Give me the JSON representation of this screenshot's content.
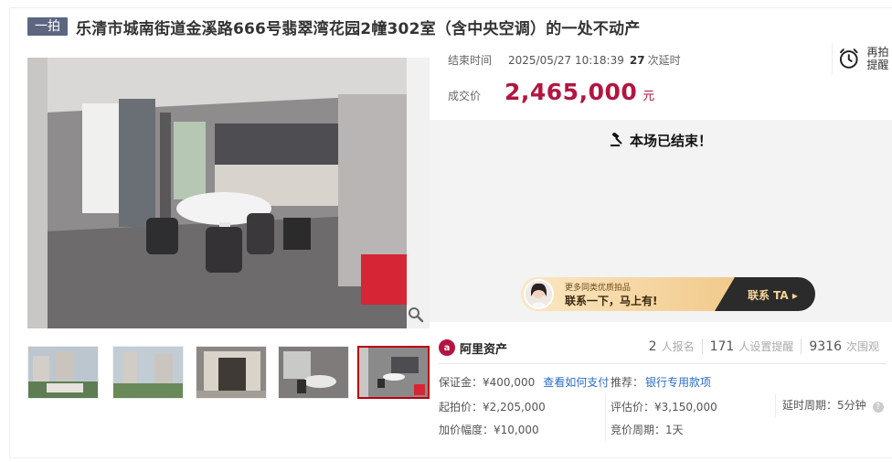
{
  "title": {
    "badge": "一拍",
    "text": "乐清市城南街道金溪路666号翡翠湾花园2幢302室（含中央空调）的一处不动产"
  },
  "auction": {
    "end_label": "结束时间",
    "end_time": "2025/05/27 10:18:39",
    "delay_count": "27",
    "delay_label": "次延时",
    "deal_label": "成交价",
    "deal_price": "2,465,000",
    "deal_unit": "元",
    "ended_message": "本场已结束！",
    "remind_label": "再拍提醒"
  },
  "banner": {
    "subtitle": "更多同类优质拍品",
    "headline": "联系一下，马上有!",
    "cta": "联系 TA ▸"
  },
  "platform": {
    "logo_glyph": "a",
    "name": "阿里资产"
  },
  "stats": [
    {
      "num": "2",
      "label": "人报名"
    },
    {
      "num": "171",
      "label": "人设置提醒"
    },
    {
      "num": "9316",
      "label": "次围观"
    }
  ],
  "details": {
    "deposit": "保证金：¥400,000",
    "deposit_link": "查看如何支付",
    "recommend_label": "推荐：",
    "recommend_link": "银行专用款项",
    "start_price": "起拍价：¥2,205,000",
    "appraisal": "评估价：¥3,150,000",
    "delay_period": "延时周期：5分钟",
    "increment": "加价幅度：¥10,000",
    "bid_period": "竞价周期：1天"
  },
  "colors": {
    "accent": "#b3153f",
    "badge": "#5c6680",
    "link": "#2b6cc4"
  }
}
